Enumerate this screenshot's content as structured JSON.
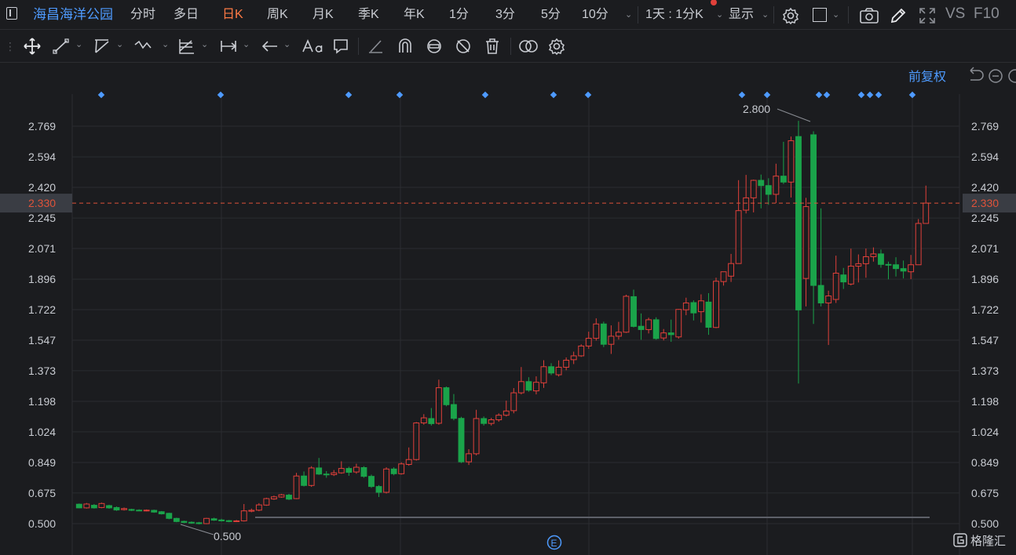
{
  "stock_name": "海昌海洋公园",
  "periods": [
    {
      "label": "分时"
    },
    {
      "label": "多日"
    },
    {
      "label": "日K"
    },
    {
      "label": "周K"
    },
    {
      "label": "月K"
    },
    {
      "label": "季K"
    },
    {
      "label": "年K"
    },
    {
      "label": "1分"
    },
    {
      "label": "3分"
    },
    {
      "label": "5分"
    },
    {
      "label": "10分"
    }
  ],
  "active_period": "日K",
  "interval_select": "1天 : 1分K",
  "display_label": "显示",
  "vs_label": "VS",
  "f10_label": "F10",
  "adjust_mode": "前复权",
  "brand": "格隆汇",
  "colors": {
    "up": "#e0403a",
    "down": "#1aa34a",
    "accent": "#ff7a45",
    "link": "#4e9bff",
    "price_line": "#e0533a",
    "bg": "#1b1c1f"
  },
  "chart_data": {
    "type": "candlestick",
    "y_ticks": [
      "2.769",
      "2.594",
      "2.420",
      "2.245",
      "2.071",
      "1.896",
      "1.722",
      "1.547",
      "1.373",
      "1.198",
      "1.024",
      "0.849",
      "0.675",
      "0.500"
    ],
    "ylim": [
      0.5,
      2.769
    ],
    "current_price": "2.330",
    "max_label": "2.800",
    "min_label": "0.500",
    "event_marker": "E",
    "candles": [
      [
        0.611,
        0.59,
        0.615,
        0.588
      ],
      [
        0.59,
        0.612,
        0.618,
        0.586
      ],
      [
        0.605,
        0.59,
        0.612,
        0.586
      ],
      [
        0.592,
        0.615,
        0.62,
        0.588
      ],
      [
        0.603,
        0.59,
        0.608,
        0.585
      ],
      [
        0.592,
        0.578,
        0.598,
        0.573
      ],
      [
        0.58,
        0.586,
        0.592,
        0.575
      ],
      [
        0.581,
        0.576,
        0.585,
        0.572
      ],
      [
        0.577,
        0.575,
        0.582,
        0.572
      ],
      [
        0.575,
        0.577,
        0.581,
        0.57
      ],
      [
        0.576,
        0.566,
        0.58,
        0.562
      ],
      [
        0.568,
        0.556,
        0.572,
        0.552
      ],
      [
        0.559,
        0.53,
        0.562,
        0.525
      ],
      [
        0.53,
        0.512,
        0.534,
        0.508
      ],
      [
        0.513,
        0.507,
        0.517,
        0.503
      ],
      [
        0.508,
        0.503,
        0.513,
        0.499
      ],
      [
        0.505,
        0.5,
        0.51,
        0.496
      ],
      [
        0.5,
        0.53,
        0.533,
        0.497
      ],
      [
        0.528,
        0.52,
        0.534,
        0.516
      ],
      [
        0.521,
        0.516,
        0.528,
        0.512
      ],
      [
        0.517,
        0.512,
        0.521,
        0.508
      ],
      [
        0.512,
        0.516,
        0.521,
        0.509
      ],
      [
        0.516,
        0.573,
        0.612,
        0.512
      ],
      [
        0.571,
        0.576,
        0.586,
        0.565
      ],
      [
        0.577,
        0.607,
        0.617,
        0.571
      ],
      [
        0.606,
        0.643,
        0.648,
        0.602
      ],
      [
        0.641,
        0.653,
        0.66,
        0.636
      ],
      [
        0.652,
        0.665,
        0.67,
        0.648
      ],
      [
        0.663,
        0.64,
        0.67,
        0.635
      ],
      [
        0.643,
        0.772,
        0.79,
        0.64
      ],
      [
        0.772,
        0.718,
        0.798,
        0.712
      ],
      [
        0.718,
        0.818,
        0.828,
        0.71
      ],
      [
        0.818,
        0.783,
        0.875,
        0.778
      ],
      [
        0.783,
        0.78,
        0.8,
        0.762
      ],
      [
        0.78,
        0.79,
        0.806,
        0.772
      ],
      [
        0.79,
        0.815,
        0.856,
        0.785
      ],
      [
        0.815,
        0.793,
        0.825,
        0.773
      ],
      [
        0.795,
        0.822,
        0.842,
        0.785
      ],
      [
        0.82,
        0.77,
        0.828,
        0.762
      ],
      [
        0.77,
        0.712,
        0.78,
        0.704
      ],
      [
        0.712,
        0.679,
        0.72,
        0.652
      ],
      [
        0.679,
        0.812,
        0.822,
        0.672
      ],
      [
        0.812,
        0.785,
        0.822,
        0.776
      ],
      [
        0.785,
        0.841,
        0.85,
        0.78
      ],
      [
        0.838,
        0.866,
        0.935,
        0.831
      ],
      [
        0.866,
        1.075,
        1.08,
        0.86
      ],
      [
        1.075,
        1.104,
        1.125,
        1.065
      ],
      [
        1.1,
        1.071,
        1.16,
        1.06
      ],
      [
        1.073,
        1.276,
        1.322,
        1.065
      ],
      [
        1.276,
        1.179,
        1.283,
        1.17
      ],
      [
        1.18,
        1.101,
        1.24,
        1.09
      ],
      [
        1.101,
        0.853,
        1.11,
        0.846
      ],
      [
        0.853,
        0.899,
        0.925,
        0.835
      ],
      [
        0.899,
        1.1,
        1.15,
        0.89
      ],
      [
        1.1,
        1.072,
        1.112,
        1.06
      ],
      [
        1.072,
        1.093,
        1.104,
        1.06
      ],
      [
        1.093,
        1.119,
        1.13,
        1.082
      ],
      [
        1.119,
        1.143,
        1.202,
        1.112
      ],
      [
        1.145,
        1.247,
        1.274,
        1.13
      ],
      [
        1.247,
        1.311,
        1.394,
        1.238
      ],
      [
        1.311,
        1.262,
        1.336,
        1.253
      ],
      [
        1.258,
        1.307,
        1.341,
        1.238
      ],
      [
        1.304,
        1.396,
        1.433,
        1.275
      ],
      [
        1.396,
        1.36,
        1.416,
        1.348
      ],
      [
        1.35,
        1.393,
        1.432,
        1.34
      ],
      [
        1.393,
        1.433,
        1.449,
        1.376
      ],
      [
        1.436,
        1.458,
        1.482,
        1.411
      ],
      [
        1.458,
        1.514,
        1.524,
        1.452
      ],
      [
        1.514,
        1.558,
        1.596,
        1.498
      ],
      [
        1.558,
        1.64,
        1.672,
        1.545
      ],
      [
        1.64,
        1.524,
        1.653,
        1.508
      ],
      [
        1.524,
        1.57,
        1.632,
        1.469
      ],
      [
        1.57,
        1.593,
        1.652,
        1.551
      ],
      [
        1.593,
        1.798,
        1.807,
        1.589
      ],
      [
        1.796,
        1.626,
        1.836,
        1.62
      ],
      [
        1.627,
        1.608,
        1.7,
        1.55
      ],
      [
        1.608,
        1.664,
        1.676,
        1.586
      ],
      [
        1.664,
        1.557,
        1.678,
        1.55
      ],
      [
        1.56,
        1.589,
        1.611,
        1.546
      ],
      [
        1.589,
        1.579,
        1.665,
        1.538
      ],
      [
        1.566,
        1.723,
        1.725,
        1.556
      ],
      [
        1.721,
        1.76,
        1.79,
        1.69
      ],
      [
        1.762,
        1.703,
        1.775,
        1.66
      ],
      [
        1.71,
        1.772,
        1.809,
        1.648
      ],
      [
        1.765,
        1.621,
        1.816,
        1.578
      ],
      [
        1.62,
        1.884,
        1.904,
        1.616
      ],
      [
        1.882,
        1.938,
        1.938,
        1.859
      ],
      [
        1.913,
        1.985,
        2.04,
        1.88
      ],
      [
        1.985,
        2.287,
        2.461,
        2.077
      ],
      [
        2.29,
        2.36,
        2.491,
        2.271
      ],
      [
        2.36,
        2.46,
        2.464,
        2.277
      ],
      [
        2.46,
        2.43,
        2.493,
        2.3
      ],
      [
        2.43,
        2.38,
        2.472,
        2.32
      ],
      [
        2.38,
        2.484,
        2.555,
        2.33
      ],
      [
        2.484,
        2.45,
        2.68,
        2.439
      ],
      [
        2.45,
        2.686,
        2.71,
        2.362
      ],
      [
        2.71,
        1.72,
        2.8,
        1.3
      ],
      [
        1.9,
        2.31,
        2.36,
        1.74
      ],
      [
        2.72,
        1.86,
        2.74,
        1.64
      ],
      [
        1.86,
        1.76,
        2.3,
        1.74
      ],
      [
        1.76,
        1.8,
        1.83,
        1.52
      ],
      [
        1.78,
        1.93,
        2.03,
        1.76
      ],
      [
        1.92,
        1.88,
        1.96,
        1.84
      ],
      [
        1.868,
        1.97,
        2.07,
        1.86
      ],
      [
        1.97,
        1.984,
        2.037,
        1.877
      ],
      [
        1.984,
        2.024,
        2.071,
        1.904
      ],
      [
        2.024,
        2.04,
        2.077,
        1.996
      ],
      [
        2.04,
        1.98,
        2.065,
        1.961
      ],
      [
        1.98,
        1.978,
        1.996,
        1.895
      ],
      [
        1.978,
        1.956,
        2.021,
        1.911
      ],
      [
        1.956,
        1.942,
        2.002,
        1.9
      ],
      [
        1.938,
        1.978,
        2.034,
        1.896
      ],
      [
        1.978,
        2.214,
        2.239,
        1.978
      ],
      [
        2.214,
        2.33,
        2.43,
        2.214
      ]
    ]
  }
}
